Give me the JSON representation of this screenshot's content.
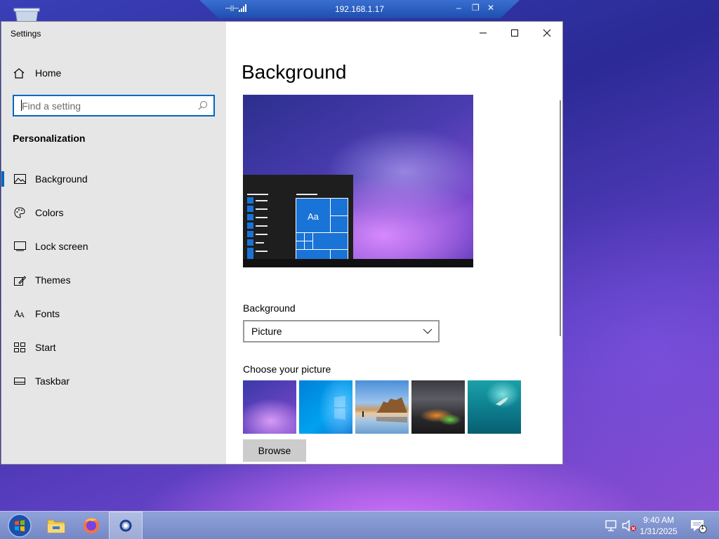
{
  "remote_bar": {
    "ip": "192.168.1.17"
  },
  "window": {
    "title": "Settings"
  },
  "sidebar": {
    "home_label": "Home",
    "search_placeholder": "Find a setting",
    "section_heading": "Personalization",
    "items": [
      {
        "label": "Background",
        "icon": "picture-icon",
        "active": true
      },
      {
        "label": "Colors",
        "icon": "palette-icon",
        "active": false
      },
      {
        "label": "Lock screen",
        "icon": "lock-screen-icon",
        "active": false
      },
      {
        "label": "Themes",
        "icon": "themes-icon",
        "active": false
      },
      {
        "label": "Fonts",
        "icon": "fonts-icon",
        "active": false
      },
      {
        "label": "Start",
        "icon": "start-icon",
        "active": false
      },
      {
        "label": "Taskbar",
        "icon": "taskbar-icon",
        "active": false
      }
    ]
  },
  "main": {
    "page_title": "Background",
    "preview_tile_text": "Aa",
    "background_label": "Background",
    "background_value": "Picture",
    "choose_label": "Choose your picture",
    "thumbnails": [
      "purple-glow",
      "windows-blue",
      "beach-rocks",
      "night-sky-tent",
      "underwater-diver"
    ],
    "browse_label": "Browse"
  },
  "taskbar": {
    "time": "9:40 AM",
    "date": "1/31/2025",
    "notification_count": "1",
    "accent": "#0067c0"
  }
}
